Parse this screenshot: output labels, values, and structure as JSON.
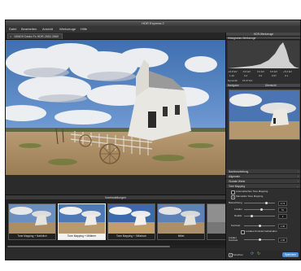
{
  "window": {
    "title": "HDR Express 2"
  },
  "menu": [
    "Datei",
    "Bearbeiten",
    "Ansicht",
    "Werkzeuge",
    "Hilfe"
  ],
  "tab": {
    "close": "×",
    "label": "150619 Darko Fo HDR-2652-2660"
  },
  "filmstrip": {
    "header": "Voreinstellungen",
    "thumbs": [
      {
        "label": "Tone Mapping + Natürlich",
        "selected": false
      },
      {
        "label": "Tone Mapping + Mittlerer",
        "selected": true
      },
      {
        "label": "Tone Mapping + Stilistisch",
        "selected": false
      },
      {
        "label": "Mittel",
        "selected": false
      },
      {
        "label": "",
        "selected": false
      }
    ]
  },
  "right_panel": {
    "main_header": "HDR-Werkzeuge",
    "histogram_header": "Histogramm-Werkzeuge",
    "stats_row1": [
      "-16.8 EV",
      "-5.6 EV",
      "0.0 EV",
      "6.5 EV",
      "+5.6 EV"
    ],
    "stats_row2": [
      "1.40",
      "0.2",
      "0.0",
      "0.57",
      "0.1"
    ],
    "dynamic_range": "Dynamik:",
    "dynamic_value": "15.07 EV",
    "navigator_header": "Navigator",
    "navigator_tab": "Übersicht",
    "sections": [
      "Nachbearbeitung",
      "Allgemein",
      "Globale Werte",
      "Tone Mapping"
    ],
    "tonemap": {
      "opt1": "Automatisches Tone Mapping",
      "opt2": "Manuelles Tone Mapping",
      "brightness_label": "Beleuchtung",
      "brightness_value": "0.73",
      "contrast_label": "Lokaler",
      "contrast_value": "51",
      "detail_label": "Details",
      "detail_value": "2",
      "kontrast_label": "Kontrast",
      "kontrast_value": "1.00",
      "checkbox_label": "Lokales Kontrast beibehalten",
      "last_label": "Lokaler Kontrast",
      "last_value": "1.00"
    },
    "bottom_left": "Vorschau",
    "ok_label": "Speichern"
  }
}
